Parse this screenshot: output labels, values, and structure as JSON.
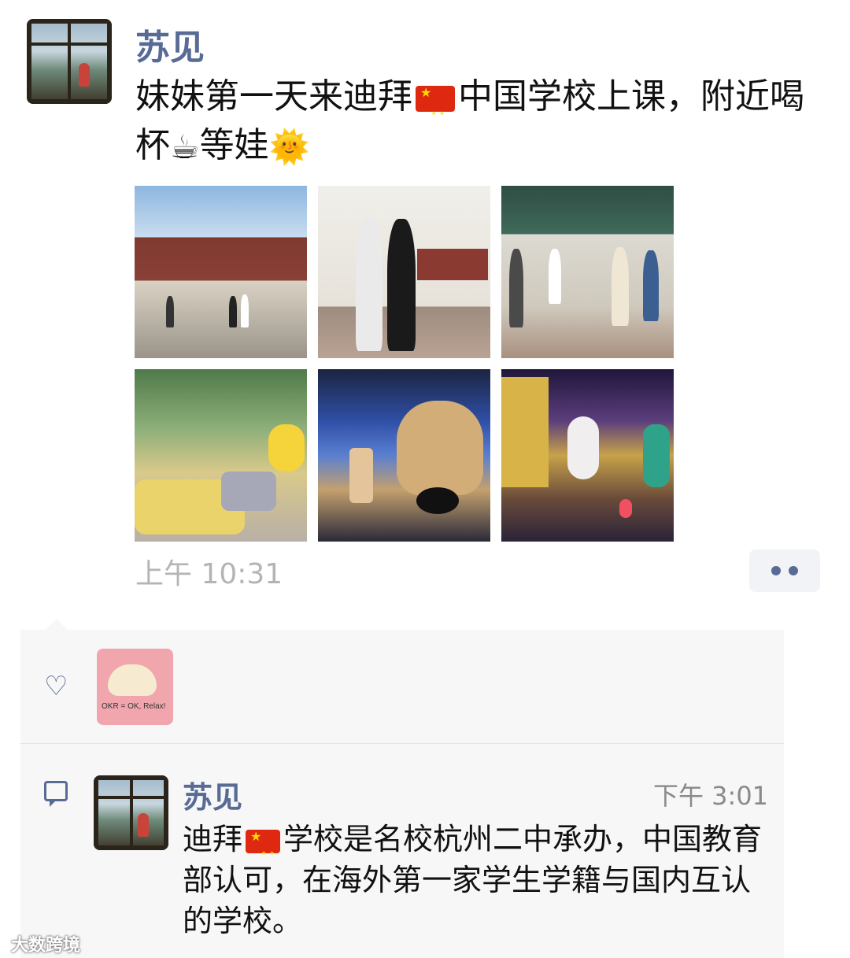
{
  "post": {
    "author": "苏见",
    "text_part1": "妹妹第一天来迪拜",
    "text_part2": "中国学校上课，附近喝杯",
    "text_part3": "等娃",
    "emoji_coffee": "☕",
    "emoji_sun": "🌞",
    "time": "上午 10:31"
  },
  "photos": [
    "photo-school-gate",
    "photo-mother-daughter",
    "photo-queue",
    "photo-cafe-pikachu",
    "photo-cafe-bear",
    "photo-cafe-graffiti"
  ],
  "comment": {
    "author": "苏见",
    "time": "下午 3:01",
    "text_part1": "迪拜",
    "text_part2": "学校是名校杭州二中承办，中国教育部认可，在海外第一家学生学籍与国内互认的学校。"
  },
  "like_avatar_text": "OKR = OK, Relax!",
  "watermark": "大数跨境",
  "colors": {
    "link": "#576b95",
    "interaction_bg": "#f7f7f7",
    "time": "#b4b4b4"
  }
}
